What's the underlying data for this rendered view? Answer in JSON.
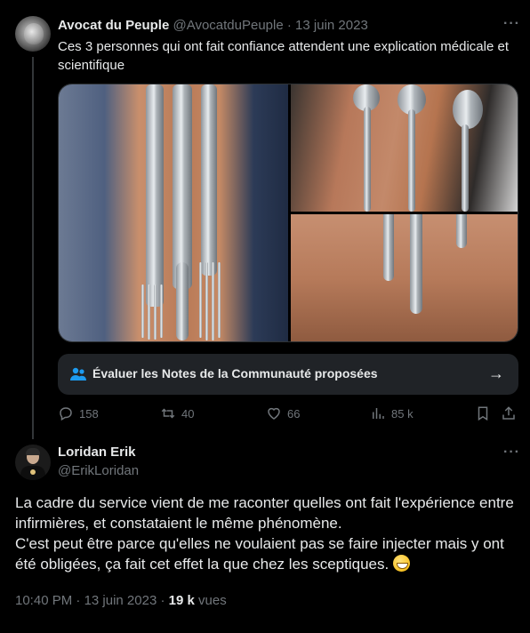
{
  "tweet1": {
    "author_name": "Avocat du Peuple",
    "author_handle": "@AvocatduPeuple",
    "separator": "·",
    "date": "13 juin 2023",
    "text": "Ces 3 personnes qui ont fait confiance attendent une explication médicale et scientifique",
    "community_notes_label": "Évaluer les Notes de la Communauté proposées",
    "stats": {
      "replies": "158",
      "retweets": "40",
      "likes": "66",
      "views": "85 k"
    }
  },
  "tweet2": {
    "author_name": "Loridan Erik",
    "author_handle": "@ErikLoridan",
    "text_p1": "La cadre du service vient de me raconter quelles ont fait l'expérience entre infirmières, et constataient le même phénomène.",
    "text_p2": "C'est peut être parce qu'elles ne voulaient pas se faire injecter mais y ont été obligées, ça fait cet effet la que chez les sceptiques.",
    "time": "10:40 PM",
    "date": "13 juin 2023",
    "views_count": "19 k",
    "views_label": "vues"
  },
  "icons": {
    "more": "more-dots-icon",
    "community": "people-icon",
    "arrow": "arrow-right-icon",
    "reply": "reply-bubble-icon",
    "retweet": "retweet-icon",
    "like": "heart-icon",
    "views": "bar-chart-icon",
    "bookmark": "bookmark-icon",
    "share": "share-icon",
    "emoji": "grinning-face-emoji"
  },
  "colors": {
    "background": "#000000",
    "primary_text": "#e7e9ea",
    "secondary_text": "#71767b",
    "accent": "#1d9bf0",
    "card": "#202327"
  }
}
